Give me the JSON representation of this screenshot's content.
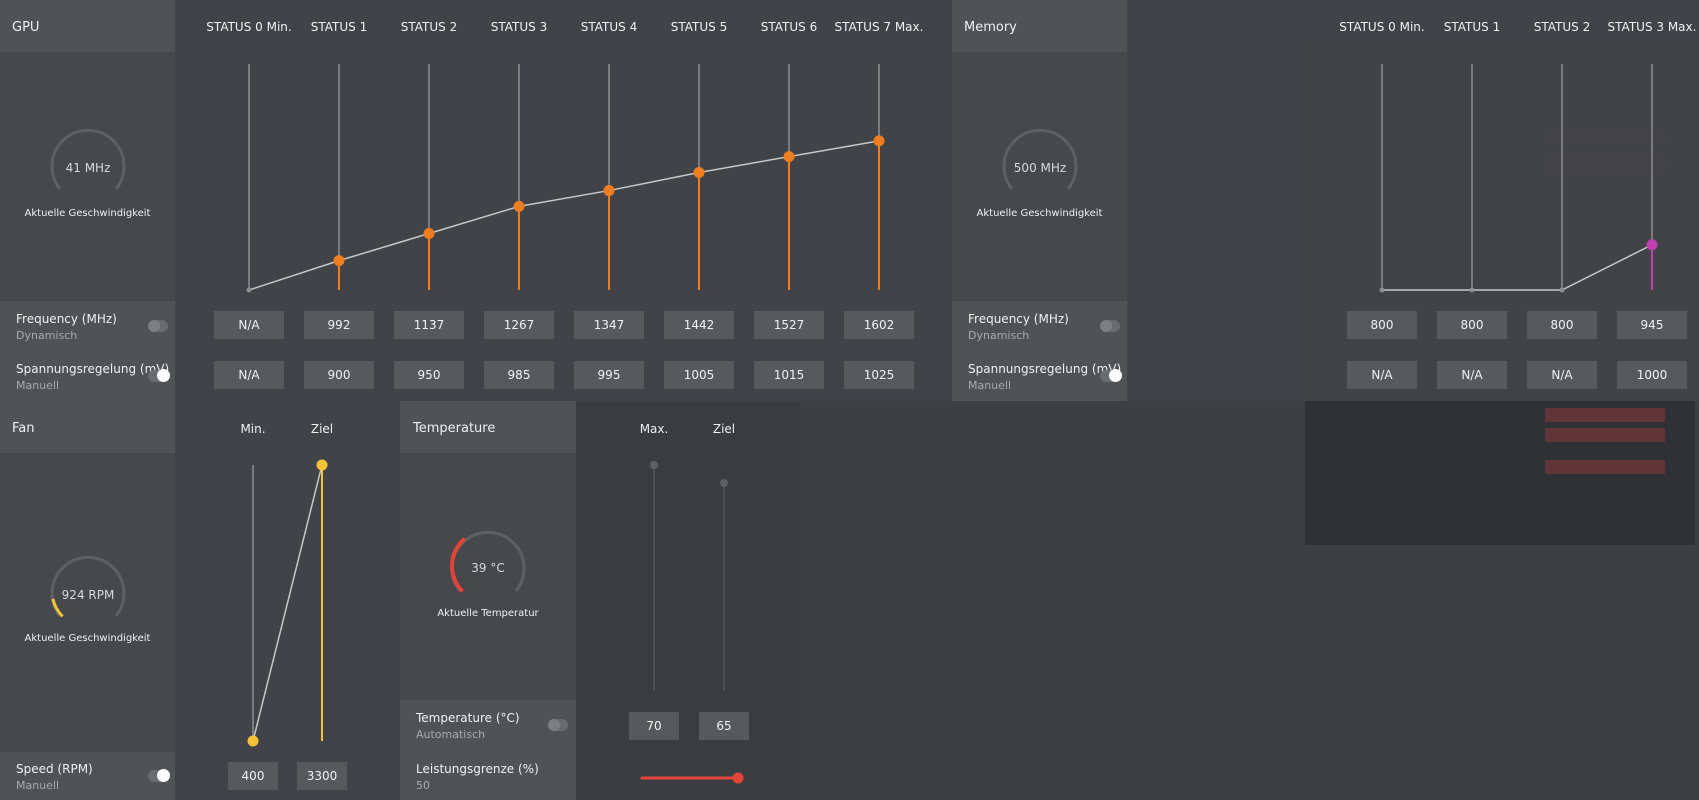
{
  "colors": {
    "accent": "#f07d1e",
    "memory_accent": "#c040b0",
    "fan_accent": "#f4c338",
    "temp_accent": "#e2443a"
  },
  "gpu": {
    "title": "GPU",
    "gauge": {
      "value": "41 MHz",
      "caption": "Aktuelle Geschwindigkeit",
      "fraction": 0.0
    },
    "states": [
      {
        "label": "STATUS 0 Min.",
        "freq": "N/A",
        "volt": "N/A",
        "level": 0.0,
        "active": false
      },
      {
        "label": "STATUS 1",
        "freq": "992",
        "volt": "900",
        "level": 0.13,
        "active": true
      },
      {
        "label": "STATUS 2",
        "freq": "1137",
        "volt": "950",
        "level": 0.25,
        "active": true
      },
      {
        "label": "STATUS 3",
        "freq": "1267",
        "volt": "985",
        "level": 0.37,
        "active": true
      },
      {
        "label": "STATUS 4",
        "freq": "1347",
        "volt": "995",
        "level": 0.44,
        "active": true
      },
      {
        "label": "STATUS 5",
        "freq": "1442",
        "volt": "1005",
        "level": 0.52,
        "active": true
      },
      {
        "label": "STATUS 6",
        "freq": "1527",
        "volt": "1015",
        "level": 0.59,
        "active": true
      },
      {
        "label": "STATUS 7 Max.",
        "freq": "1602",
        "volt": "1025",
        "level": 0.66,
        "active": true
      }
    ],
    "frequency": {
      "label": "Frequency (MHz)",
      "mode": "Dynamisch",
      "toggle_on": false
    },
    "voltage": {
      "label": "Spannungsregelung (mV)",
      "mode": "Manuell",
      "toggle_on": true
    }
  },
  "memory": {
    "title": "Memory",
    "gauge": {
      "value": "500 MHz",
      "caption": "Aktuelle Geschwindigkeit",
      "fraction": 0.0
    },
    "states": [
      {
        "label": "STATUS 0 Min.",
        "freq": "800",
        "volt": "N/A",
        "level": 0.0,
        "active": false
      },
      {
        "label": "STATUS 1",
        "freq": "800",
        "volt": "N/A",
        "level": 0.0,
        "active": false
      },
      {
        "label": "STATUS 2",
        "freq": "800",
        "volt": "N/A",
        "level": 0.0,
        "active": false
      },
      {
        "label": "STATUS 3 Max.",
        "freq": "945",
        "volt": "1000",
        "level": 0.2,
        "active": true
      }
    ],
    "frequency": {
      "label": "Frequency (MHz)",
      "mode": "Dynamisch",
      "toggle_on": false
    },
    "voltage": {
      "label": "Spannungsregelung (mV)",
      "mode": "Manuell",
      "toggle_on": true
    }
  },
  "fan": {
    "title": "Fan",
    "gauge": {
      "value": "924 RPM",
      "caption": "Aktuelle Geschwindigkeit",
      "fraction": 0.12
    },
    "min_label": "Min.",
    "target_label": "Ziel",
    "min_value": "400",
    "target_value": "3300",
    "min_level": 0.0,
    "target_level": 1.0,
    "speed": {
      "label": "Speed (RPM)",
      "mode": "Manuell",
      "toggle_on": true
    }
  },
  "temperature": {
    "title": "Temperature",
    "gauge": {
      "value": "39 °C",
      "caption": "Aktuelle Temperatur",
      "fraction": 0.35
    },
    "max_label": "Max.",
    "target_label": "Ziel",
    "max_value": "70",
    "target_value": "65",
    "max_level": 1.0,
    "target_level": 0.92,
    "setting": {
      "label": "Temperature (°C)",
      "mode": "Automatisch",
      "toggle_on": false
    },
    "power_limit": {
      "label": "Leistungsgrenze (%)",
      "value": "50",
      "fraction": 1.0
    }
  }
}
